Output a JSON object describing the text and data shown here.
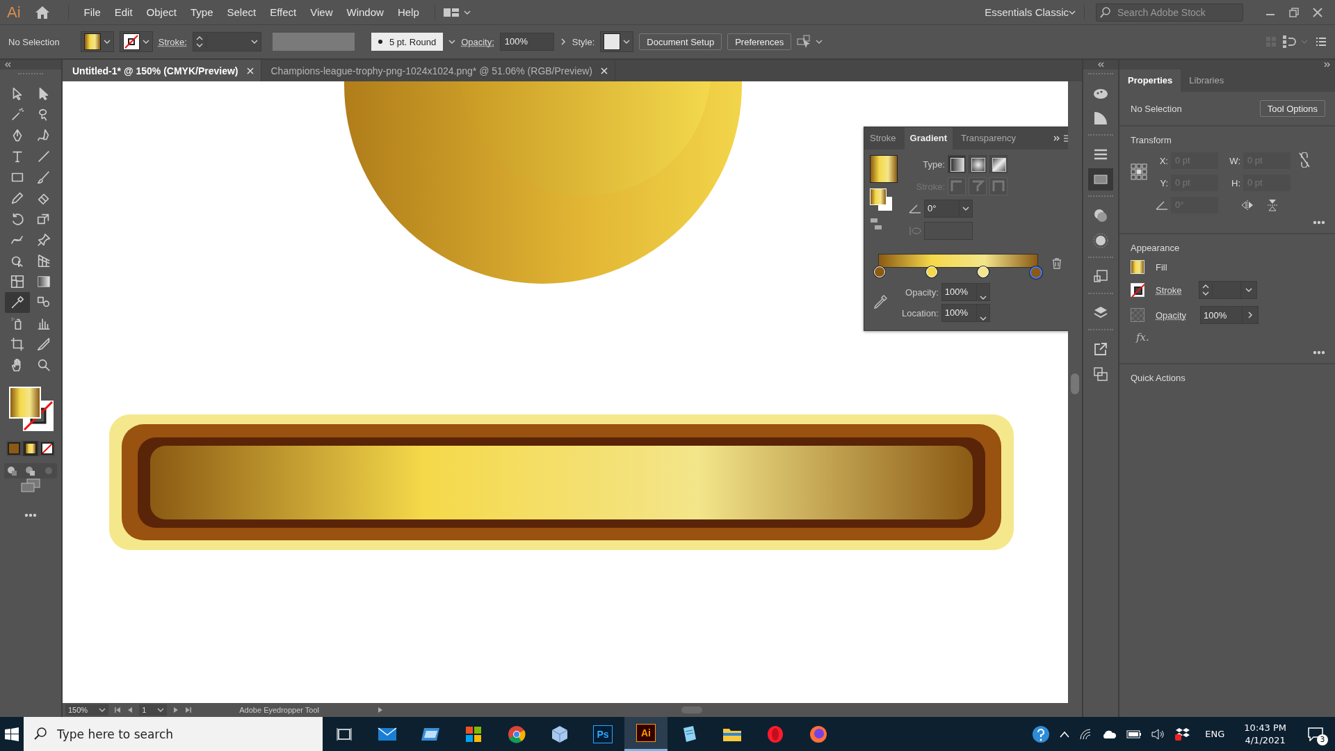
{
  "app": {
    "logo": "Ai"
  },
  "menu": [
    "File",
    "Edit",
    "Object",
    "Type",
    "Select",
    "Effect",
    "View",
    "Window",
    "Help"
  ],
  "workspace": {
    "label": "Essentials Classic",
    "search_placeholder": "Search Adobe Stock"
  },
  "control_bar": {
    "selection": "No Selection",
    "stroke_label": "Stroke:",
    "brush": "5 pt. Round",
    "opacity_label": "Opacity:",
    "opacity": "100%",
    "style_label": "Style:",
    "buttons": [
      "Document Setup",
      "Preferences"
    ]
  },
  "document_tabs": [
    {
      "title": "Untitled-1* @ 150% (CMYK/Preview)",
      "selected": true
    },
    {
      "title": "Champions-league-trophy-png-1024x1024.png* @ 51.06% (RGB/Preview)",
      "selected": false
    }
  ],
  "tools": [
    {
      "kind": "select",
      "selected": false
    },
    {
      "kind": "direct-select",
      "selected": false
    },
    {
      "kind": "wand",
      "selected": false
    },
    {
      "kind": "lasso",
      "selected": false
    },
    {
      "kind": "pen",
      "selected": false
    },
    {
      "kind": "curvature",
      "selected": false
    },
    {
      "kind": "type",
      "selected": false
    },
    {
      "kind": "line",
      "selected": false
    },
    {
      "kind": "rectangle",
      "selected": false
    },
    {
      "kind": "brush",
      "selected": false
    },
    {
      "kind": "pencil",
      "selected": false
    },
    {
      "kind": "eraser",
      "selected": false
    },
    {
      "kind": "rotate",
      "selected": false
    },
    {
      "kind": "scale",
      "selected": false
    },
    {
      "kind": "warp",
      "selected": false
    },
    {
      "kind": "pin",
      "selected": false
    },
    {
      "kind": "shape-builder",
      "selected": false
    },
    {
      "kind": "perspective",
      "selected": false
    },
    {
      "kind": "mesh",
      "selected": false
    },
    {
      "kind": "gradient",
      "selected": false
    },
    {
      "kind": "eyedropper",
      "selected": true
    },
    {
      "kind": "blend",
      "selected": false
    },
    {
      "kind": "sprayer",
      "selected": false
    },
    {
      "kind": "graph",
      "selected": false
    },
    {
      "kind": "artboard",
      "selected": false
    },
    {
      "kind": "slice",
      "selected": false
    },
    {
      "kind": "hand",
      "selected": false
    },
    {
      "kind": "zoom",
      "selected": false
    }
  ],
  "gradient_stops": [
    {
      "color": "#8b5a14",
      "selected": false
    },
    {
      "color": "#f5d94a",
      "selected": false
    },
    {
      "color": "#f3e58a",
      "selected": false
    },
    {
      "color": "#8b5a14",
      "selected": true
    }
  ],
  "gradient_panel": {
    "tabs": [
      {
        "label": "Stroke",
        "selected": false
      },
      {
        "label": "Gradient",
        "selected": true
      },
      {
        "label": "Transparency",
        "selected": false
      }
    ],
    "type_label": "Type:",
    "types": [
      {
        "kind": "linear",
        "selected": true
      },
      {
        "kind": "radial",
        "selected": false
      },
      {
        "kind": "freeform",
        "selected": false
      }
    ],
    "stroke_label": "Stroke:",
    "angle": "0°",
    "opacity_label": "Opacity:",
    "opacity": "100%",
    "location_label": "Location:",
    "location": "100%"
  },
  "panel_strip": [
    {
      "kind": "palette",
      "selected": false
    },
    {
      "kind": "wedge",
      "selected": false
    },
    {
      "kind": "lines",
      "selected": false
    },
    {
      "kind": "gradient",
      "selected": true
    },
    {
      "kind": "circles",
      "selected": false
    },
    {
      "kind": "sun",
      "selected": false
    },
    {
      "kind": "squares",
      "selected": false
    },
    {
      "kind": "layers",
      "selected": false
    },
    {
      "kind": "export",
      "selected": false
    },
    {
      "kind": "artboards",
      "selected": false
    }
  ],
  "properties": {
    "tabs": [
      {
        "label": "Properties",
        "selected": true
      },
      {
        "label": "Libraries",
        "selected": false
      }
    ],
    "selection": "No Selection",
    "tool_options": "Tool Options",
    "transform_title": "Transform",
    "fields": [
      {
        "label": "X:",
        "value": "0 pt"
      },
      {
        "label": "W:",
        "value": "0 pt"
      },
      {
        "label": "Y:",
        "value": "0 pt"
      },
      {
        "label": "H:",
        "value": "0 pt"
      }
    ],
    "angle": "0°",
    "appearance_title": "Appearance",
    "fill_label": "Fill",
    "stroke_label": "Stroke",
    "opacity_label": "Opacity",
    "opacity": "100%",
    "fx": "fx.",
    "quick_actions_title": "Quick Actions"
  },
  "status_bar": {
    "zoom": "150%",
    "page": "1",
    "tool": "Adobe Eyedropper Tool"
  },
  "taskbar": {
    "search_placeholder": "Type here to search",
    "apps": [
      {
        "kind": "task-view",
        "selected": false
      },
      {
        "kind": "mail",
        "selected": false
      },
      {
        "kind": "tablet",
        "selected": false
      },
      {
        "kind": "store",
        "selected": false
      },
      {
        "kind": "chrome",
        "selected": false
      },
      {
        "kind": "cube",
        "selected": false
      },
      {
        "kind": "ps",
        "label": "Ps",
        "selected": false
      },
      {
        "kind": "ai",
        "label": "Ai",
        "selected": true
      },
      {
        "kind": "notepad",
        "selected": false
      },
      {
        "kind": "folder",
        "selected": false
      },
      {
        "kind": "opera",
        "selected": false
      },
      {
        "kind": "firefox",
        "selected": false
      }
    ],
    "language": "ENG",
    "time": "10:43 PM",
    "date": "4/1/2021",
    "notifications": "3"
  }
}
